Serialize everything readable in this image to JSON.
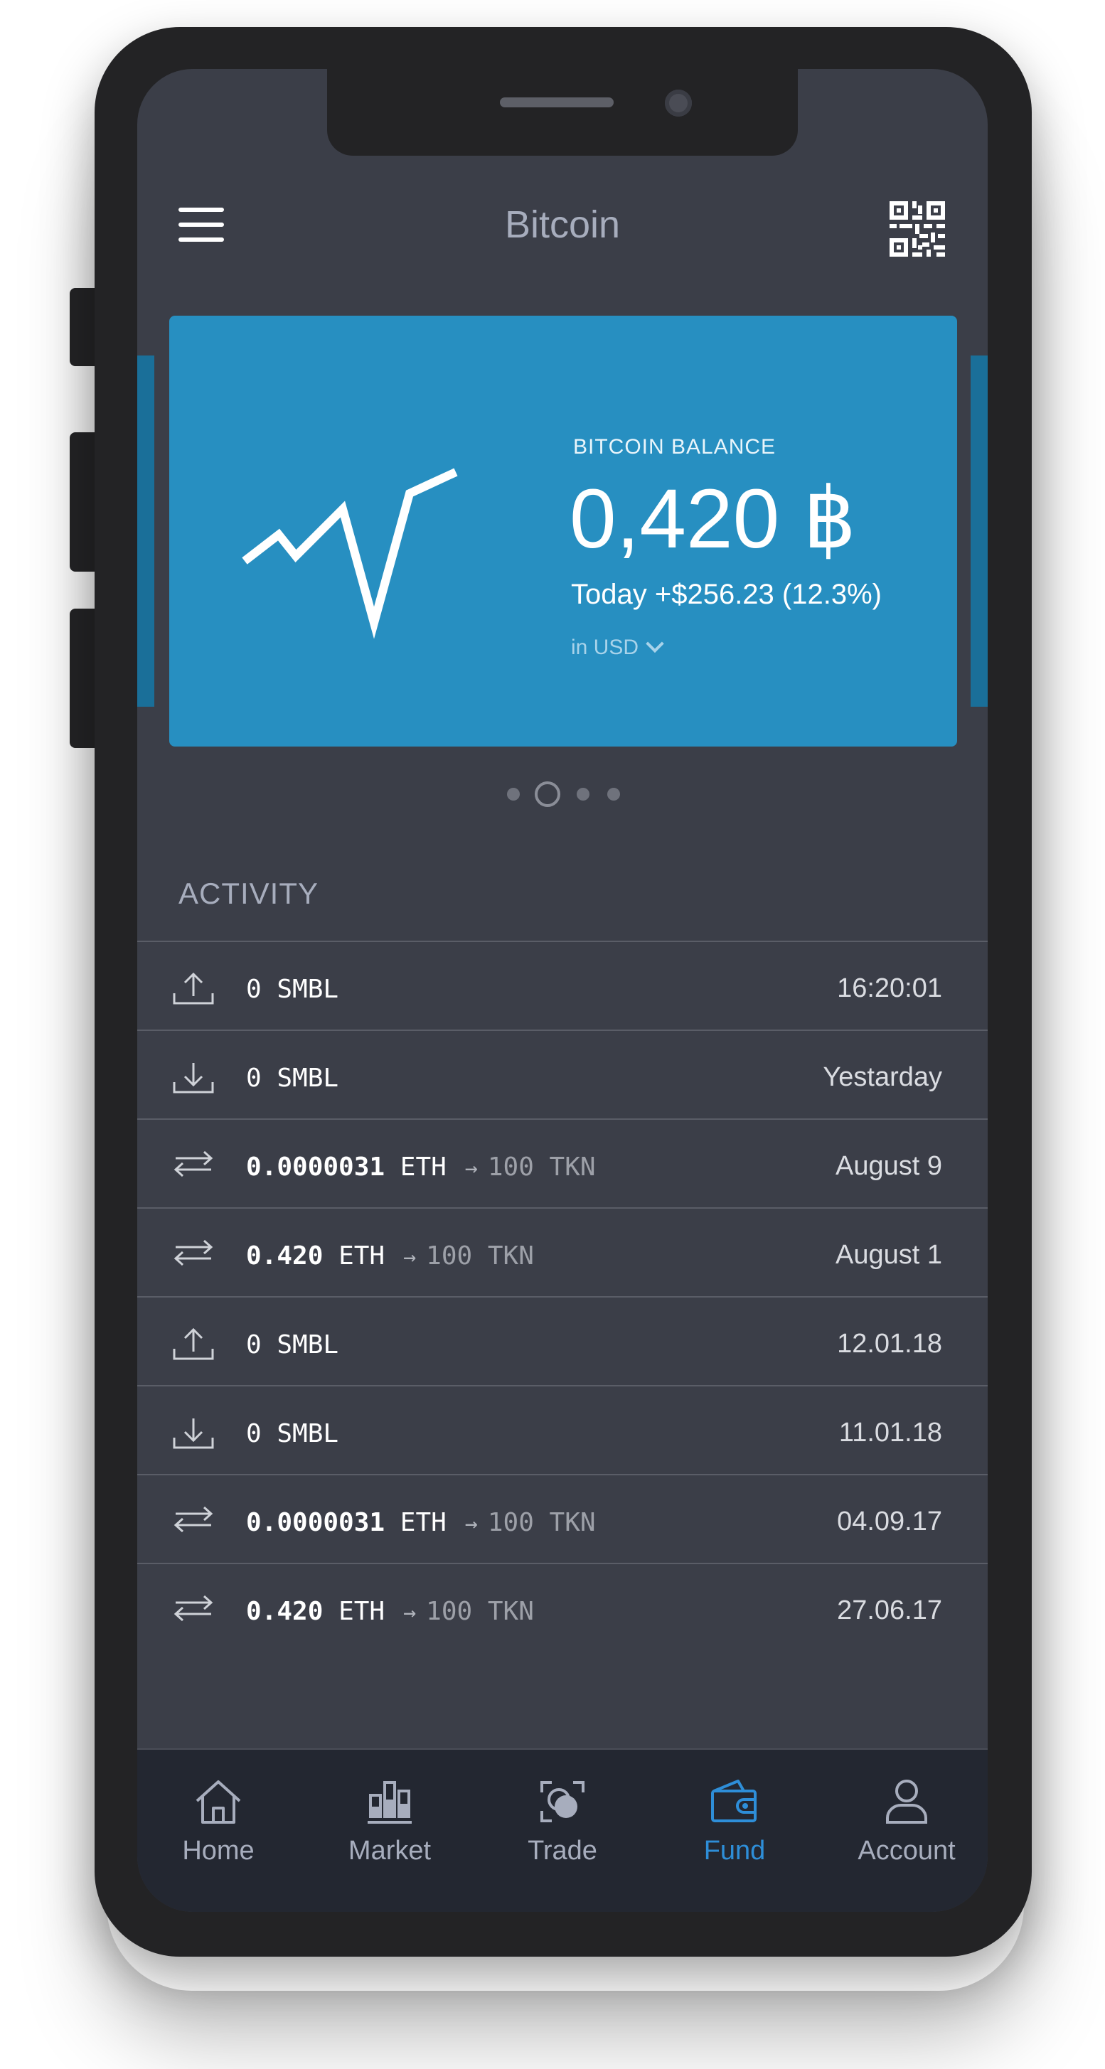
{
  "header": {
    "title": "Bitcoin"
  },
  "balance_card": {
    "label": "BITCOIN BALANCE",
    "amount": "0,420 ฿",
    "today": "Today +$256.23  (12.3%)",
    "currency": "in USD"
  },
  "carousel": {
    "count": 4,
    "active_index": 1
  },
  "activity": {
    "title": "ACTIVITY",
    "rows": [
      {
        "icon": "upload-icon",
        "amount": "0 SMBL",
        "date": "16:20:01"
      },
      {
        "icon": "download-icon",
        "amount": "0 SMBL",
        "date": "Yestarday"
      },
      {
        "icon": "exchange-icon",
        "amount": "0.0000031",
        "unit": "ETH",
        "arrow": "→",
        "to": "100 TKN",
        "date": "August 9"
      },
      {
        "icon": "exchange-icon",
        "amount": "0.420",
        "unit": "ETH",
        "arrow": "→",
        "to": "100 TKN",
        "date": "August 1"
      },
      {
        "icon": "upload-icon",
        "amount": "0 SMBL",
        "date": "12.01.18"
      },
      {
        "icon": "download-icon",
        "amount": "0 SMBL",
        "date": "11.01.18"
      },
      {
        "icon": "exchange-icon",
        "amount": "0.0000031",
        "unit": "ETH",
        "arrow": "→",
        "to": "100 TKN",
        "date": "04.09.17"
      },
      {
        "icon": "exchange-icon",
        "amount": "0.420",
        "unit": "ETH",
        "arrow": "→",
        "to": "100 TKN",
        "date": "27.06.17"
      }
    ]
  },
  "nav": {
    "items": [
      {
        "label": "Home",
        "icon": "home-icon"
      },
      {
        "label": "Market",
        "icon": "market-icon"
      },
      {
        "label": "Trade",
        "icon": "trade-icon"
      },
      {
        "label": "Fund",
        "icon": "wallet-icon",
        "active": true
      },
      {
        "label": "Account",
        "icon": "user-icon"
      }
    ]
  },
  "colors": {
    "screen_bg": "#3b3e48",
    "card_bg": "#278fc1",
    "accent": "#2e8ed8",
    "muted_text": "#a7adbd"
  }
}
